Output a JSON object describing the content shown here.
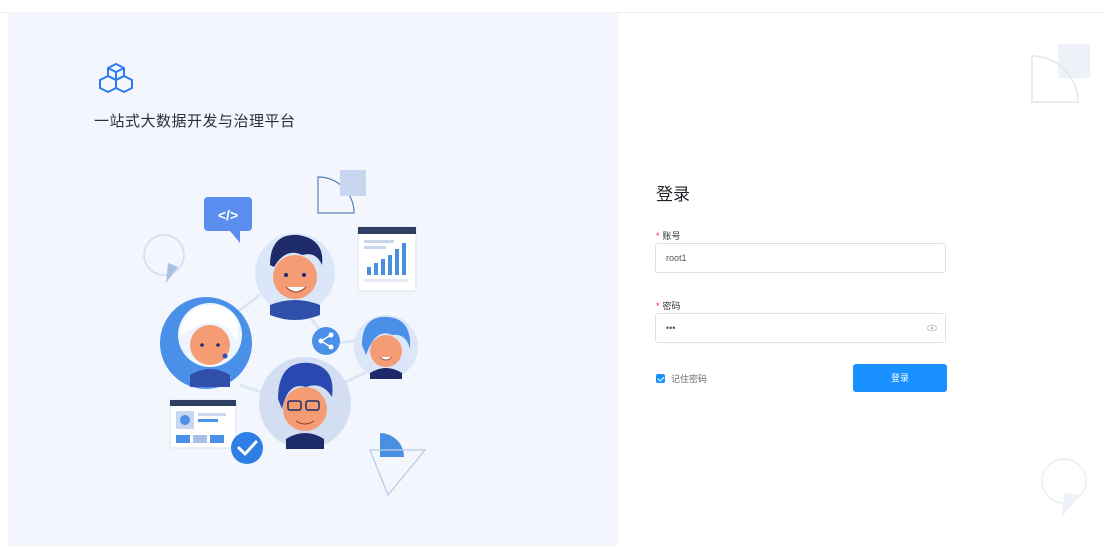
{
  "brand": {
    "title": "一站式大数据开发与治理平台"
  },
  "login": {
    "title": "登录",
    "account_label": "账号",
    "account_value": "root1",
    "password_label": "密码",
    "password_value": "•••",
    "remember_label": "记住密码",
    "remember_checked": true,
    "submit_label": "登录"
  },
  "illustration": {
    "code_tag": "</>"
  },
  "colors": {
    "primary": "#1890ff",
    "left_bg": "#f3f7fd",
    "required": "#f5222d"
  }
}
